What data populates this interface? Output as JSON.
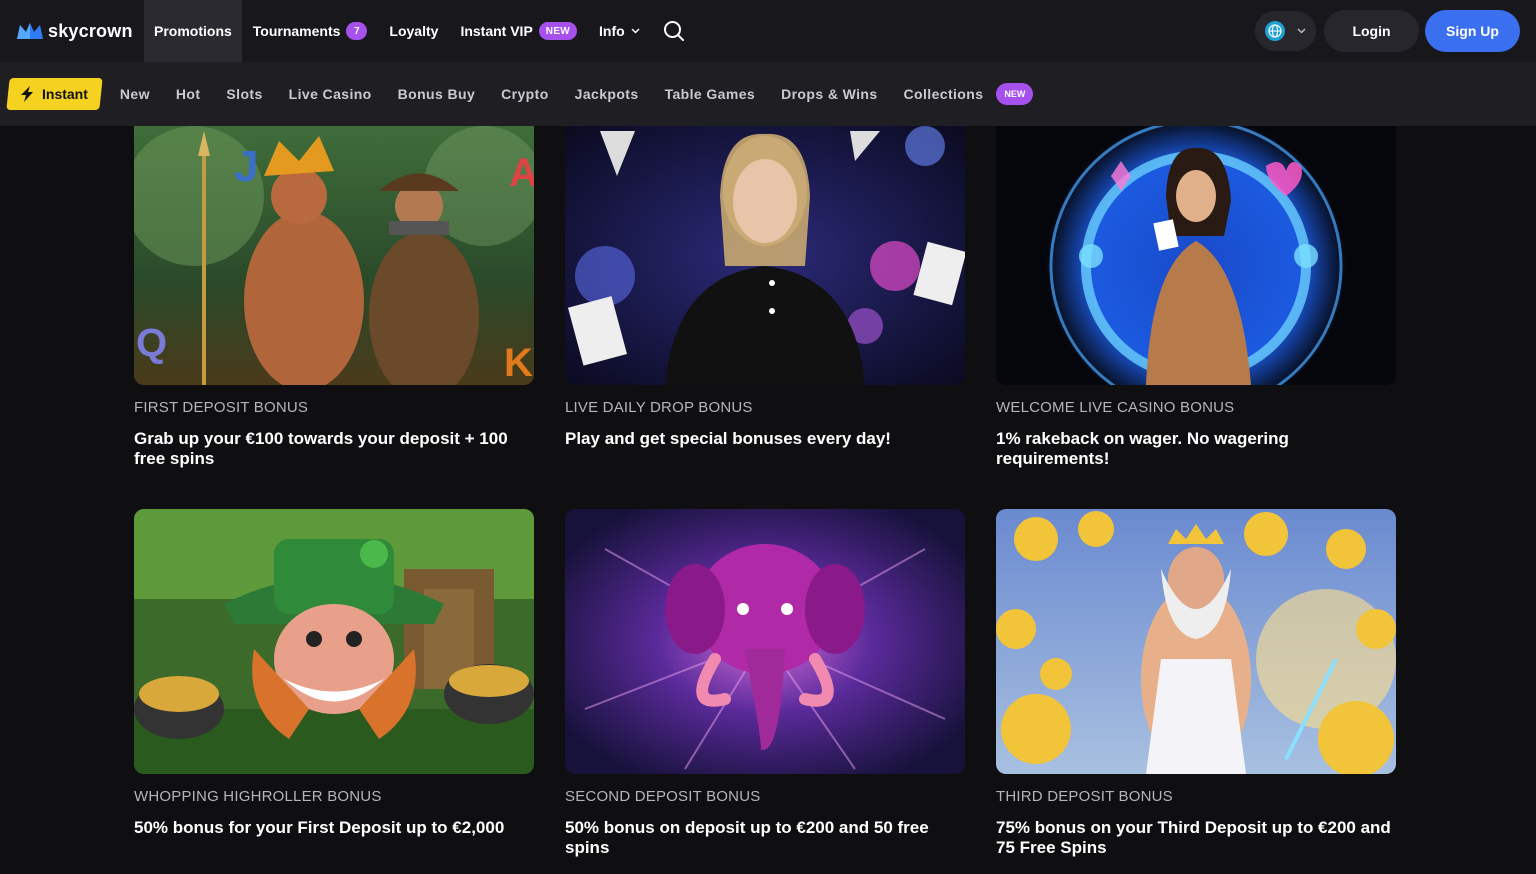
{
  "brand": {
    "name": "skycrown"
  },
  "nav": {
    "items": [
      {
        "label": "Promotions",
        "active": true
      },
      {
        "label": "Tournaments",
        "badge": "7"
      },
      {
        "label": "Loyalty"
      },
      {
        "label": "Instant VIP",
        "badge": "NEW"
      },
      {
        "label": "Info",
        "dropdown": true
      }
    ],
    "login": "Login",
    "signup": "Sign Up",
    "icons": {
      "search": "search-icon",
      "language": "globe-icon"
    }
  },
  "categories": {
    "instant": "Instant",
    "items": [
      "New",
      "Hot",
      "Slots",
      "Live Casino",
      "Bonus Buy",
      "Crypto",
      "Jackpots",
      "Table Games",
      "Drops & Wins",
      "Collections"
    ],
    "collections_badge": "NEW"
  },
  "promos": [
    {
      "kicker": "FIRST DEPOSIT BONUS",
      "title": "Grab up your €100 towards your deposit + 100 free spins",
      "image": "jungle-warrior-explorer"
    },
    {
      "kicker": "LIVE DAILY DROP BONUS",
      "title": "Play and get special bonuses every day!",
      "image": "live-dealer-woman"
    },
    {
      "kicker": "WELCOME LIVE CASINO BONUS",
      "title": "1% rakeback on wager. No wagering requirements!",
      "image": "woman-blue-portal"
    },
    {
      "kicker": "WHOPPING HIGHROLLER BONUS",
      "title": "50% bonus for your First Deposit up to €2,000",
      "image": "leprechaun-gold"
    },
    {
      "kicker": "SECOND DEPOSIT BONUS",
      "title": "50% bonus on deposit up to €200 and 50 free spins",
      "image": "purple-mammoth"
    },
    {
      "kicker": "THIRD DEPOSIT BONUS",
      "title": "75% bonus on your Third Deposit up to €200 and 75 Free Spins",
      "image": "zeus-gold-coins"
    }
  ],
  "colors": {
    "accent": "#3a6ff0",
    "badge": "#a650ee",
    "instant": "#f5d21f",
    "background": "#0f0f12"
  }
}
